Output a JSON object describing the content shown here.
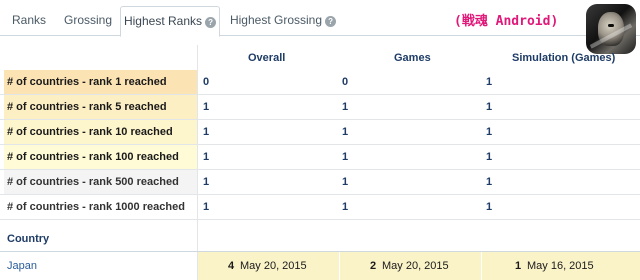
{
  "tabs": [
    {
      "label": "Ranks"
    },
    {
      "label": "Grossing"
    },
    {
      "label": "Highest Ranks",
      "help": "?"
    },
    {
      "label": "Highest Grossing",
      "help": "?"
    }
  ],
  "app": {
    "title": "(戦魂 Android)"
  },
  "table": {
    "columns": [
      "Overall",
      "Games",
      "Simulation (Games)"
    ],
    "rows": [
      {
        "label": "# of countries - rank 1 reached",
        "values": [
          "0",
          "0",
          "1"
        ],
        "color": "#fbe3b4"
      },
      {
        "label": "# of countries - rank 5 reached",
        "values": [
          "1",
          "1",
          "1"
        ],
        "color": "#fdefc4"
      },
      {
        "label": "# of countries - rank 10 reached",
        "values": [
          "1",
          "1",
          "1"
        ],
        "color": "#fdf5cc"
      },
      {
        "label": "# of countries - rank 100 reached",
        "values": [
          "1",
          "1",
          "1"
        ],
        "color": "#fefbd6"
      },
      {
        "label": "# of countries - rank 500 reached",
        "values": [
          "1",
          "1",
          "1"
        ],
        "color": "#f4f4f4"
      },
      {
        "label": "# of countries - rank 1000 reached",
        "values": [
          "1",
          "1",
          "1"
        ],
        "color": "#ffffff"
      }
    ],
    "country_header": "Country",
    "countries": [
      {
        "name": "Japan",
        "cells": [
          {
            "rank": "4",
            "date": "May 20, 2015"
          },
          {
            "rank": "2",
            "date": "May 20, 2015"
          },
          {
            "rank": "1",
            "date": "May 16, 2015"
          }
        ]
      }
    ]
  }
}
